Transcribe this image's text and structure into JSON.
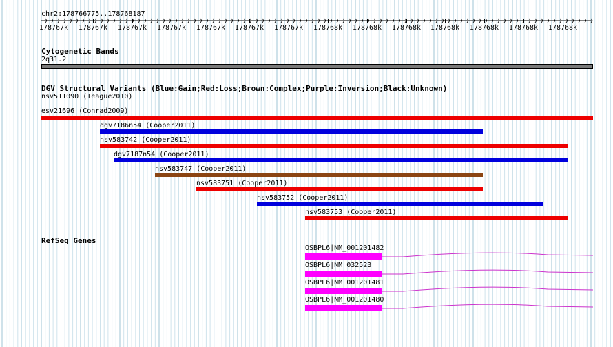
{
  "position_label": "chr2:178766775..178768187",
  "ruler_ticks": [
    "178767k",
    "178767k",
    "178767k",
    "178767k",
    "178767k",
    "178767k",
    "178767k",
    "178768k",
    "178768k",
    "178768k",
    "178768k",
    "178768k",
    "178768k",
    "178768k"
  ],
  "cytoband": {
    "title": "Cytogenetic Bands",
    "band": "2q31.2",
    "color": "#7a7a7a"
  },
  "dgv": {
    "title": "DGV Structural Variants (Blue:Gain;Red:Loss;Brown:Complex;Purple:Inversion;Black:Unknown)",
    "colors": {
      "gain": "#0000dd",
      "loss": "#ee0000",
      "complex": "#8b4513",
      "unknown": "#000000"
    },
    "variants": [
      {
        "label": "nsv511090 (Teague2010)",
        "type": "unknown"
      },
      {
        "label": "esv21696 (Conrad2009)",
        "type": "loss"
      },
      {
        "label": "dgv7186n54 (Cooper2011)",
        "type": "gain"
      },
      {
        "label": "nsv583742 (Cooper2011)",
        "type": "loss"
      },
      {
        "label": "dgv7187n54 (Cooper2011)",
        "type": "gain"
      },
      {
        "label": "nsv583747 (Cooper2011)",
        "type": "complex"
      },
      {
        "label": "nsv583751 (Cooper2011)",
        "type": "loss"
      },
      {
        "label": "nsv583752 (Cooper2011)",
        "type": "gain"
      },
      {
        "label": "nsv583753 (Cooper2011)",
        "type": "loss"
      }
    ]
  },
  "refseq": {
    "title": "RefSeq Genes",
    "exon_color": "#ff00ff",
    "intron_color": "#cc33cc",
    "genes": [
      {
        "label": "OSBPL6|NM_001201482"
      },
      {
        "label": "OSBPL6|NM_032523"
      },
      {
        "label": "OSBPL6|NM_001201481"
      },
      {
        "label": "OSBPL6|NM_001201480"
      }
    ]
  }
}
